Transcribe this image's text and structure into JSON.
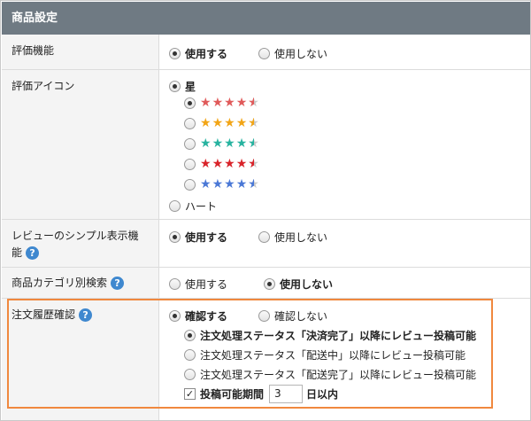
{
  "header": {
    "title": "商品設定"
  },
  "rows": {
    "rating": {
      "label": "評価機能",
      "use": "使用する",
      "nouse": "使用しない"
    },
    "icon": {
      "label": "評価アイコン",
      "star": "星",
      "heart": "ハート"
    },
    "simple": {
      "label_line1": "レビューのシンプル表示機",
      "label_line2": "能",
      "use": "使用する",
      "nouse": "使用しない"
    },
    "category": {
      "label": "商品カテゴリ別検索",
      "use": "使用する",
      "nouse": "使用しない"
    },
    "order": {
      "label": "注文履歴確認",
      "confirm": "確認する",
      "noconfirm": "確認しない",
      "sub1": "注文処理ステータス「決済完了」以降にレビュー投稿可能",
      "sub2": "注文処理ステータス「配送中」以降にレビュー投稿可能",
      "sub3": "注文処理ステータス「配送完了」以降にレビュー投稿可能",
      "period_label": "投稿可能期間",
      "period_value": "3",
      "period_unit": "日以内"
    }
  },
  "help_icon": "?",
  "star_sets": [
    {
      "color": "#e05a5a",
      "rating": 4.5
    },
    {
      "color": "#f2a516",
      "rating": 4.5
    },
    {
      "color": "#27b3a0",
      "rating": 4.5
    },
    {
      "color": "#d9242a",
      "rating": 4.5
    },
    {
      "color": "#4a78d6",
      "rating": 4.5
    }
  ],
  "colors": {
    "header_bg": "#6f7a83",
    "help_blue": "#3f88cf",
    "highlight_orange": "#f0883e"
  }
}
